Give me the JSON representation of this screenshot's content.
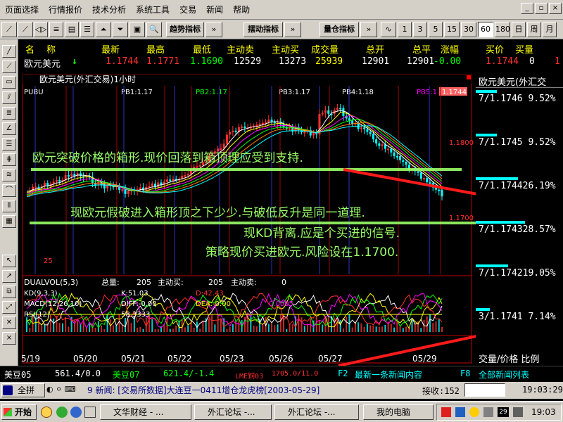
{
  "menu": [
    "页面选择",
    "行情报价",
    "技术分析",
    "系统工具",
    "交易",
    "新闻",
    "帮助"
  ],
  "toolbar": {
    "indicator_buttons": [
      "趋势指标",
      "摆动指标",
      "量仓指标"
    ],
    "period_buttons": [
      "1",
      "3",
      "5",
      "15",
      "30",
      "60",
      "180",
      "日",
      "周",
      "月"
    ],
    "selected_period": "60"
  },
  "quote": {
    "headers": [
      "名",
      "称",
      "最新",
      "最高",
      "最低",
      "主动卖",
      "主动买",
      "成交量",
      "总开",
      "总平",
      "涨幅",
      "买价",
      "买量"
    ],
    "name": "欧元美元",
    "arrow": "↓",
    "last": "1.1744",
    "high": "1.1771",
    "low": "1.1690",
    "active_sell": "12529",
    "active_buy": "13273",
    "volume": "25939",
    "total_open": "12901",
    "total_close": "12901",
    "change": "-0.00",
    "bid": "1.1744",
    "bid_vol": "0",
    "bid_vol2": "1"
  },
  "chart": {
    "title": "欧元美元(外汇交易)1小时",
    "indicator_name": "PUBU",
    "pb_labels": [
      "PB1:1.17",
      "PB2:1.17",
      "PB3:1.17",
      "PB4:1.18",
      "PB5:1.18"
    ],
    "pb5_value": "1.1744",
    "axis_value_top": "1.1800",
    "axis_value_mid": "1.1700",
    "low_marker": "25",
    "annotations": [
      "欧元突破价格的箱形.现价回落到箱顶理应受到支持.",
      "现欧元假破进入箱形顶之下少少.与破低反升是同一道理.",
      "现KD背离.应是个买进的信号.",
      "策略现价买进欧元.风险设在1.1700."
    ],
    "sub": {
      "dualvol": "DUALVOL(5,3)",
      "total_label": "总量:",
      "total_value": "205",
      "active_buy_label": "主动买:",
      "active_buy_value": "205",
      "active_sell_label": "主动卖:",
      "active_sell_value": "0",
      "kd": "KD(9,3,3)",
      "k": "K:51.03",
      "d": "D:42.43",
      "macd": "MACD(12,26,10)",
      "diff": "DIFF:-0.00",
      "dea": "DEA:-0.00",
      "macd_val": "0.0005",
      "rsi": "RSI(12)",
      "rsi_val": "58.3333"
    },
    "dates": [
      "5/19",
      "05/20",
      "05/21",
      "05/22",
      "05/23",
      "05/26",
      "05/27",
      "05/29"
    ]
  },
  "right_panel": {
    "title": "欧元美元(外汇交",
    "rows": [
      "7/1.1746  9.52%",
      "7/1.1745  9.52%",
      "7/1.174426.19%",
      "7/1.174328.57%",
      "7/1.174219.05%",
      "3/1.1741  7.14%"
    ],
    "footer": "交量/价格  比例"
  },
  "futures": [
    {
      "name": "美豆05",
      "value": "561.4/0.0"
    },
    {
      "name": "美豆07",
      "value": "621.4/-1.4"
    },
    {
      "name": "LME铜03",
      "value": "1705.0/11.0"
    }
  ],
  "news_hotkeys": {
    "f2": "F2",
    "f2_text": "最新一条新闻内容",
    "f8": "F8",
    "f8_text": "全部新闻列表"
  },
  "newsbar": {
    "full_screen": "全拼",
    "ticker": "9 新闻: [交易所数据]大连豆一0411增仓龙虎榜[2003-05-29]",
    "recv_label": "接收:152",
    "time": "19:03:29"
  },
  "taskbar": {
    "start": "开始",
    "tasks": [
      "文华财经 - ...",
      "外汇论坛 -...",
      "外汇论坛 -...",
      "我的电脑"
    ],
    "clock": "19:03"
  },
  "colors": {
    "price_line": "#ffffff",
    "box_line": "#99ff66",
    "annotation": "#99ff66",
    "cyan": "#00ffff",
    "red": "#ff2020",
    "yellow": "#ffff00"
  }
}
